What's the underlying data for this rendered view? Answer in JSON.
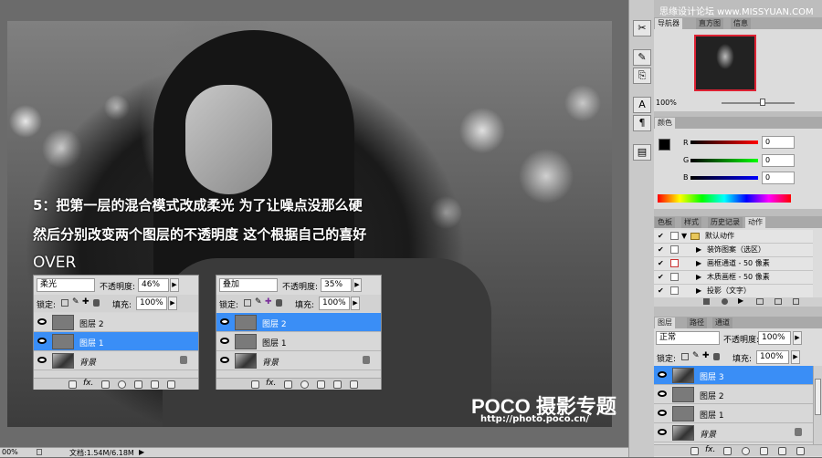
{
  "watermark_top": "思缘设计论坛 www.MISSYUAN.COM",
  "tutorial": {
    "line1": "5：把第一层的混合模式改成柔光 为了让噪点没那么硬",
    "line2": "然后分别改变两个图层的不透明度 这个根据自己的喜好",
    "line3": "OVER"
  },
  "mini_panel_left": {
    "blend_mode": "柔光",
    "opacity_label": "不透明度:",
    "opacity": "46%",
    "lock_label": "锁定:",
    "fill_label": "填充:",
    "fill": "100%",
    "layers": [
      {
        "name": "图层 2",
        "selected": false
      },
      {
        "name": "图层 1",
        "selected": true
      },
      {
        "name": "背景",
        "selected": false
      }
    ]
  },
  "mini_panel_right": {
    "blend_mode": "叠加",
    "opacity_label": "不透明度:",
    "opacity": "35%",
    "lock_label": "锁定:",
    "fill_label": "填充:",
    "fill": "100%",
    "layers": [
      {
        "name": "图层 2",
        "selected": true
      },
      {
        "name": "图层 1",
        "selected": false
      },
      {
        "name": "背景",
        "selected": false
      }
    ]
  },
  "poco_logo": "POCO 摄影专题",
  "poco_url": "http://photo.poco.cn/",
  "status_bar": {
    "zoom": "00%",
    "doc": "文档:1.54M/6.18M"
  },
  "navigator": {
    "tabs": [
      "导航器",
      "直方图",
      "信息"
    ],
    "zoom": "100%"
  },
  "color_panel": {
    "tab": "颜色",
    "channels": [
      {
        "label": "R",
        "value": "0"
      },
      {
        "label": "G",
        "value": "0"
      },
      {
        "label": "B",
        "value": "0"
      }
    ]
  },
  "actions_panel": {
    "tabs": [
      "色板",
      "样式",
      "历史记录",
      "动作"
    ],
    "items": [
      {
        "name": "默认动作",
        "checked": true,
        "folder": true
      },
      {
        "name": "装饰图案（选区）",
        "checked": true,
        "folder": false
      },
      {
        "name": "画框通道 - 50 像素",
        "checked": true,
        "folder": false
      },
      {
        "name": "木质画框 - 50 像素",
        "checked": true,
        "folder": false
      },
      {
        "name": "投影（文字）",
        "checked": true,
        "folder": false
      }
    ]
  },
  "layers_panel": {
    "tabs": [
      "图层",
      "路径",
      "通道"
    ],
    "blend_mode": "正常",
    "opacity_label": "不透明度:",
    "opacity": "100%",
    "lock_label": "锁定:",
    "fill_label": "填充:",
    "fill": "100%",
    "layers": [
      {
        "name": "图层 3",
        "selected": true
      },
      {
        "name": "图层 2",
        "selected": false
      },
      {
        "name": "图层 1",
        "selected": false
      },
      {
        "name": "背景",
        "selected": false
      }
    ]
  },
  "colors": {
    "selection": "#3a8ef6",
    "panel_bg": "#dcdcdc"
  }
}
